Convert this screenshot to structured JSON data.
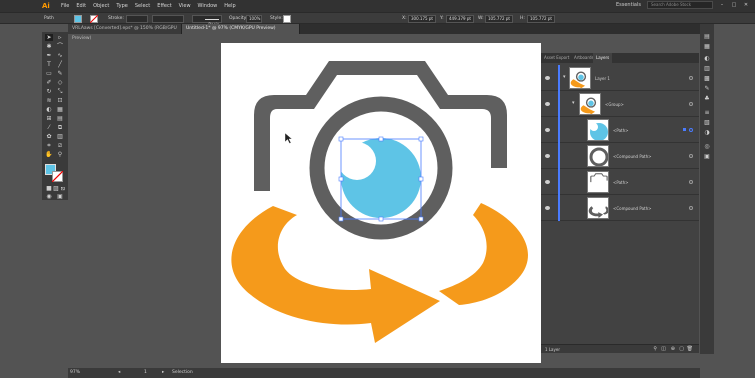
{
  "app": {
    "logo": "Ai"
  },
  "menu": [
    "File",
    "Edit",
    "Object",
    "Type",
    "Select",
    "Effect",
    "View",
    "Window",
    "Help"
  ],
  "menubar_right": {
    "essentials": "Essentials",
    "search_placeholder": "Search Adobe Stock",
    "window_buttons": [
      "–",
      "□",
      "✕"
    ]
  },
  "control": {
    "selection": "Path",
    "stroke_label": "Stroke:",
    "brush": "Basic",
    "opacity_label": "Opacity:",
    "opacity_value": "100%",
    "style_label": "Style:",
    "x_label": "X:",
    "x_value": "300.175 pt",
    "y_label": "Y:",
    "y_value": "449.379 pt",
    "w_label": "W:",
    "w_value": "105.772 pt",
    "h_label": "H:",
    "h_value": "105.772 pt",
    "fill_color": "#5ec4e6"
  },
  "tabs": [
    {
      "label": "VRLAaws [Converted].eps* @ 150% (RGB/GPU Preview)",
      "active": false
    },
    {
      "label": "Untitled-1* @ 97% (CMYK/GPU Preview)",
      "active": true
    }
  ],
  "layers_panel": {
    "tabs": [
      "Asset Export",
      "Artboards",
      "Layers"
    ],
    "active_tab": "Layers",
    "rows": [
      {
        "name": "Layer 1",
        "thumb": "full"
      },
      {
        "name": "<Group>",
        "thumb": "full"
      },
      {
        "name": "<Path>",
        "thumb": "blue-circle"
      },
      {
        "name": "<Compound Path>",
        "thumb": "ring"
      },
      {
        "name": "<Path>",
        "thumb": "camera"
      },
      {
        "name": "<Compound Path>",
        "thumb": "arrows"
      }
    ],
    "footer": "1 Layer"
  },
  "status": {
    "zoom": "97%",
    "artboard_num": "1",
    "tool": "Selection"
  },
  "colors": {
    "orange": "#f59a1b",
    "gray": "#5f5f5f",
    "blue": "#5ec4e6",
    "selection": "#4a7cff"
  }
}
